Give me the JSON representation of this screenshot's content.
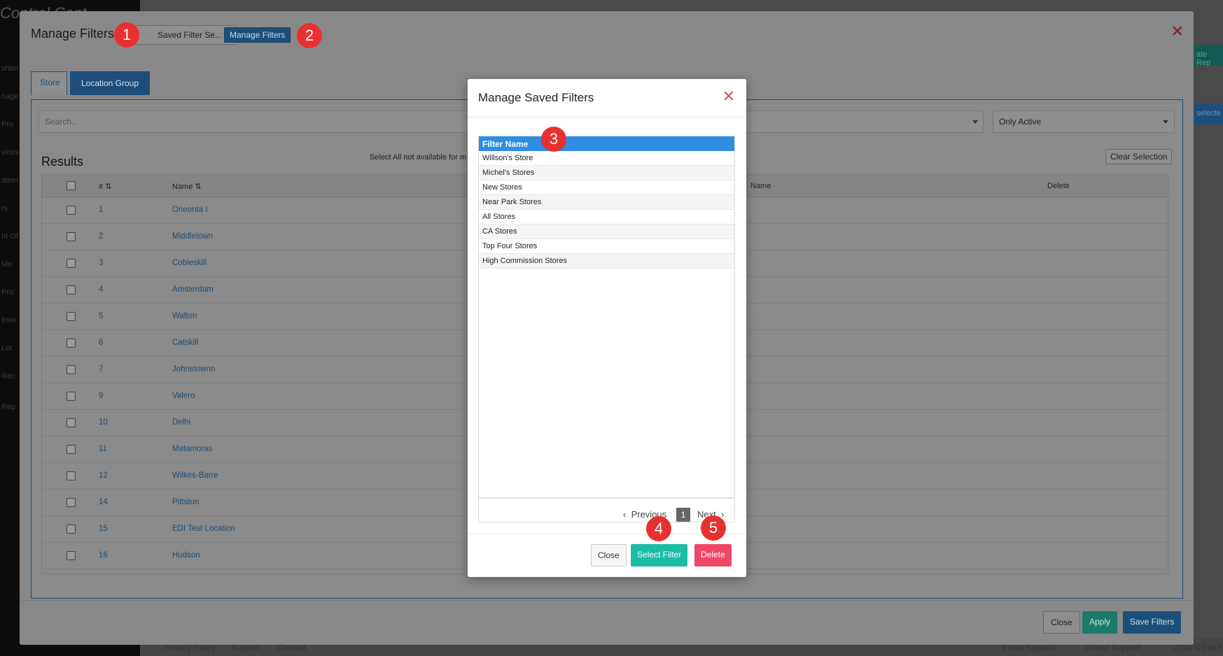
{
  "background": {
    "logo": "Control Cent",
    "sidebar_items": [
      "shbo",
      "nage",
      "Pro",
      "vices",
      "ation",
      "rs",
      "nt Of",
      "Me",
      "Pric",
      "Inve",
      "Lot",
      "Rec",
      "Rep"
    ],
    "footer_links": [
      "Privacy Policy",
      "Support",
      "Contact"
    ],
    "footer_right": [
      "Email Support",
      "Phone Support",
      "2024 © FasT"
    ],
    "right_tiles": [
      "ate Rep",
      "selecte"
    ]
  },
  "outer": {
    "title": "Manage Filters",
    "saved_filter_select": "Saved Filter Se...",
    "manage_filters_button": "Manage Filters",
    "tabs": [
      "Store",
      "Location Group"
    ],
    "search_placeholder": "Search...",
    "status_select": "Only Active",
    "results_title": "Results",
    "select_all_note": "Select All not available for m",
    "clear_selection": "Clear Selection",
    "columns": [
      "#",
      "Name",
      "Name",
      "Delete"
    ],
    "rows": [
      {
        "num": "1",
        "name": "Oneonta I"
      },
      {
        "num": "2",
        "name": "Middletown"
      },
      {
        "num": "3",
        "name": "Cobleskill"
      },
      {
        "num": "4",
        "name": "Amsterdam"
      },
      {
        "num": "5",
        "name": "Walton"
      },
      {
        "num": "6",
        "name": "Catskill"
      },
      {
        "num": "7",
        "name": "Johnstownn"
      },
      {
        "num": "9",
        "name": "Valero"
      },
      {
        "num": "10",
        "name": "Delhi"
      },
      {
        "num": "11",
        "name": "Matamoras"
      },
      {
        "num": "12",
        "name": "Wilkes-Barre"
      },
      {
        "num": "14",
        "name": "Pittston"
      },
      {
        "num": "15",
        "name": "EDI Test Location"
      },
      {
        "num": "16",
        "name": "Hudson"
      }
    ],
    "footer_buttons": {
      "close": "Close",
      "apply": "Apply",
      "save": "Save Filters"
    }
  },
  "inner": {
    "title": "Manage Saved Filters",
    "column": "Filter Name",
    "filters": [
      "Willson's Store",
      "Michel's Stores",
      "New Stores",
      "Near Park Stores",
      "All Stores",
      "CA Stores",
      "Top Four Stores",
      "High Commission Stores"
    ],
    "pager": {
      "previous": "Previous",
      "page": "1",
      "next": "Next"
    },
    "buttons": {
      "close": "Close",
      "select": "Select Filter",
      "delete": "Delete"
    }
  },
  "badges": [
    "1",
    "2",
    "3",
    "4",
    "5"
  ],
  "colors": {
    "primary": "#2f8de4",
    "teal": "#1cbda5",
    "danger": "#ef4866",
    "badge": "#e8312f"
  }
}
